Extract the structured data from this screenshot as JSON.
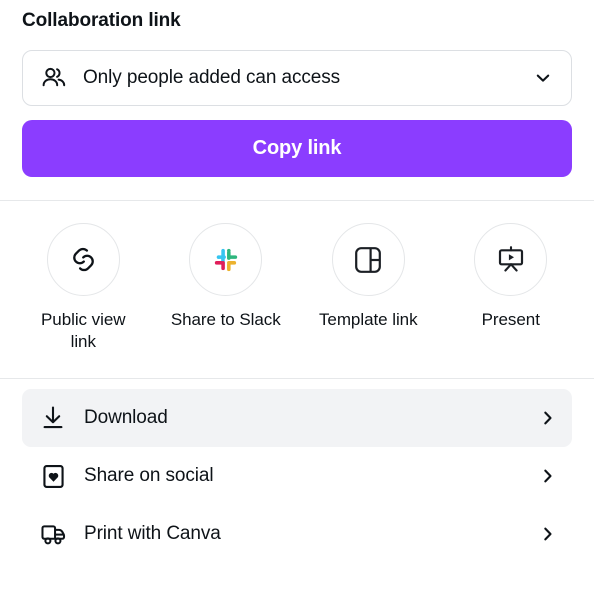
{
  "collaboration": {
    "title": "Collaboration link",
    "access": {
      "icon": "people-icon",
      "value": "Only people added can access",
      "chevron": "chevron-down-icon"
    },
    "copy_button_label": "Copy link"
  },
  "quick_actions": [
    {
      "label": "Public view link",
      "icon": "link-chain-icon"
    },
    {
      "label": "Share to Slack",
      "icon": "slack-icon"
    },
    {
      "label": "Template link",
      "icon": "template-layout-icon"
    },
    {
      "label": "Present",
      "icon": "presentation-play-icon"
    }
  ],
  "list_rows": [
    {
      "label": "Download",
      "icon": "download-icon",
      "chevron": "chevron-right-icon",
      "highlighted": true
    },
    {
      "label": "Share on social",
      "icon": "heart-square-icon",
      "chevron": "chevron-right-icon",
      "highlighted": false
    },
    {
      "label": "Print with Canva",
      "icon": "delivery-truck-icon",
      "chevron": "chevron-right-icon",
      "highlighted": false
    }
  ],
  "colors": {
    "brand_purple": "#8B3DFF",
    "text_primary": "#0E1318",
    "row_highlight": "#F2F3F5",
    "divider": "#E6E8EA",
    "border": "#DCDFE3",
    "slack_blue": "#36C5F0",
    "slack_green": "#2EB67D",
    "slack_red": "#E01E5A",
    "slack_yellow": "#ECB22E"
  }
}
